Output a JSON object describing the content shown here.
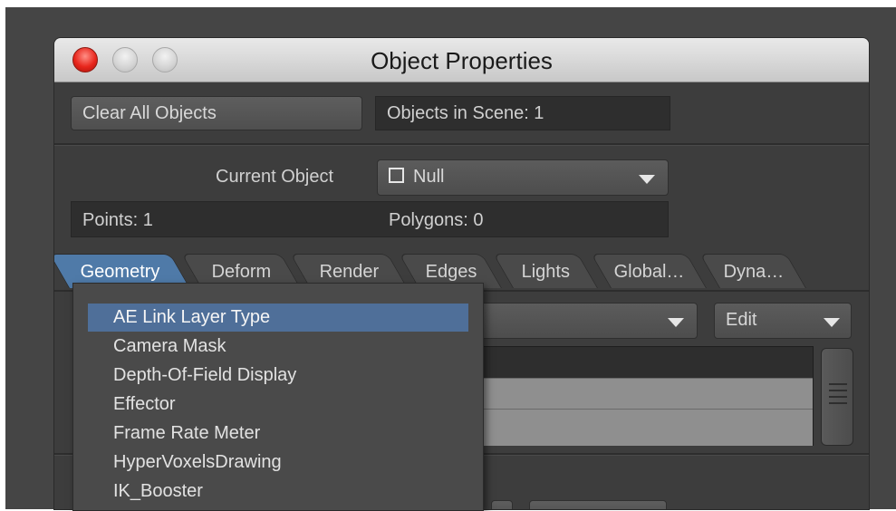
{
  "window": {
    "title": "Object Properties"
  },
  "toolbar": {
    "clear_all_label": "Clear All Objects",
    "objects_in_scene": "Objects in Scene: 1"
  },
  "object": {
    "current_label": "Current Object",
    "current_value": "Null",
    "points": "Points: 1",
    "polygons": "Polygons: 0"
  },
  "tabs": [
    {
      "label": "Geometry",
      "active": true
    },
    {
      "label": "Deform"
    },
    {
      "label": "Render"
    },
    {
      "label": "Edges"
    },
    {
      "label": "Lights"
    },
    {
      "label": "Global…"
    },
    {
      "label": "Dyna…"
    }
  ],
  "controls": {
    "edit_label": "Edit"
  },
  "menu": {
    "items": [
      "AE Link Layer Type",
      "Camera Mask",
      "Depth-Of-Field Display",
      "Effector",
      "Frame Rate Meter",
      "HyperVoxelsDrawing",
      "IK_Booster"
    ],
    "selected_index": 0
  },
  "colors": {
    "accent_tab": "#4f7aa8",
    "menu_highlight": "#4f6f99",
    "close_light": "#e8261c"
  }
}
